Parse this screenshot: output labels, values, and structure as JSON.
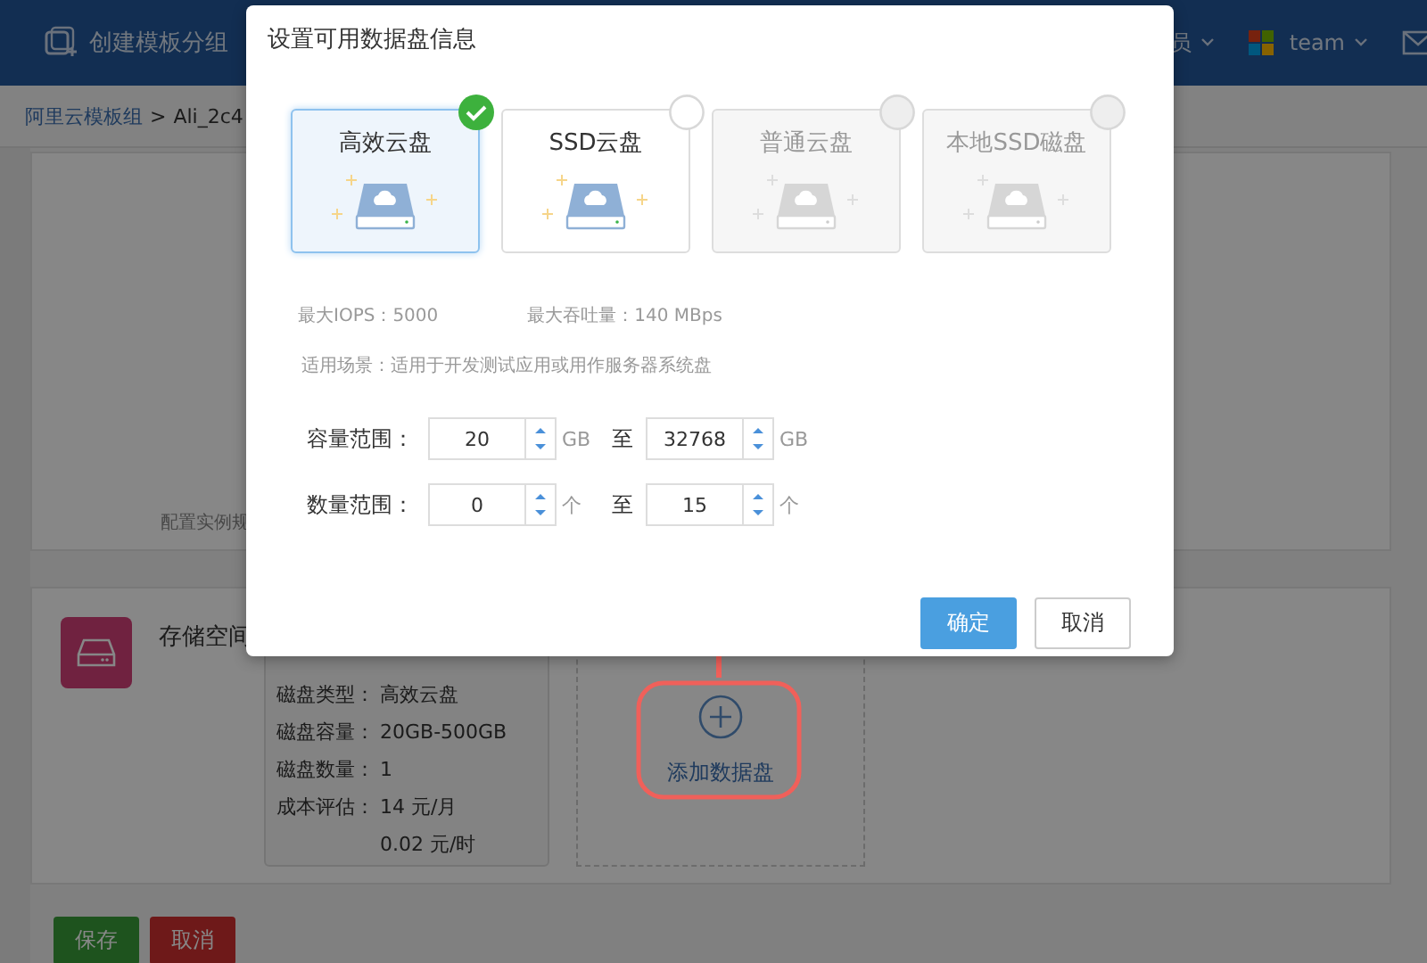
{
  "header": {
    "create_group": "创建模板分组",
    "user_menu": "员",
    "team": "team"
  },
  "breadcrumb": {
    "parent": "阿里云模板组",
    "separator": ">",
    "current": "Ali_2c4"
  },
  "instance_section": {
    "label": "配置实例规"
  },
  "storage": {
    "title": "存储空间",
    "disk_info": [
      {
        "label": "磁盘类型：",
        "value": "高效云盘"
      },
      {
        "label": "磁盘容量：",
        "value": "20GB-500GB"
      },
      {
        "label": "磁盘数量：",
        "value": "1"
      },
      {
        "label": "成本评估：",
        "value": "14 元/月"
      },
      {
        "value": "0.02 元/时"
      }
    ],
    "add_label": "添加数据盘"
  },
  "footer_buttons": [
    {
      "label": "保存",
      "kind": "primary"
    },
    {
      "label": "取消",
      "kind": "danger"
    }
  ],
  "dialog": {
    "title": "设置可用数据盘信息",
    "disk_types": [
      {
        "name": "高效云盘",
        "selected": true,
        "disabled": false
      },
      {
        "name": "SSD云盘",
        "selected": false,
        "disabled": false
      },
      {
        "name": "普通云盘",
        "selected": false,
        "disabled": true
      },
      {
        "name": "本地SSD磁盘",
        "selected": false,
        "disabled": true
      }
    ],
    "specs": [
      "最大IOPS：5000",
      "最大吞吐量：140 MBps"
    ],
    "scenario": "适用场景：适用于开发测试应用或用作服务器系统盘",
    "ranges": [
      {
        "label": "容量范围：",
        "min": "20",
        "min_unit": "GB",
        "to": "至",
        "max": "32768",
        "max_unit": "GB"
      },
      {
        "label": "数量范围：",
        "min": "0",
        "min_unit": "个",
        "to": "至",
        "max": "15",
        "max_unit": "个"
      }
    ],
    "buttons": [
      {
        "label": "确定",
        "kind": "primary"
      },
      {
        "label": "取消",
        "kind": "default"
      }
    ]
  }
}
